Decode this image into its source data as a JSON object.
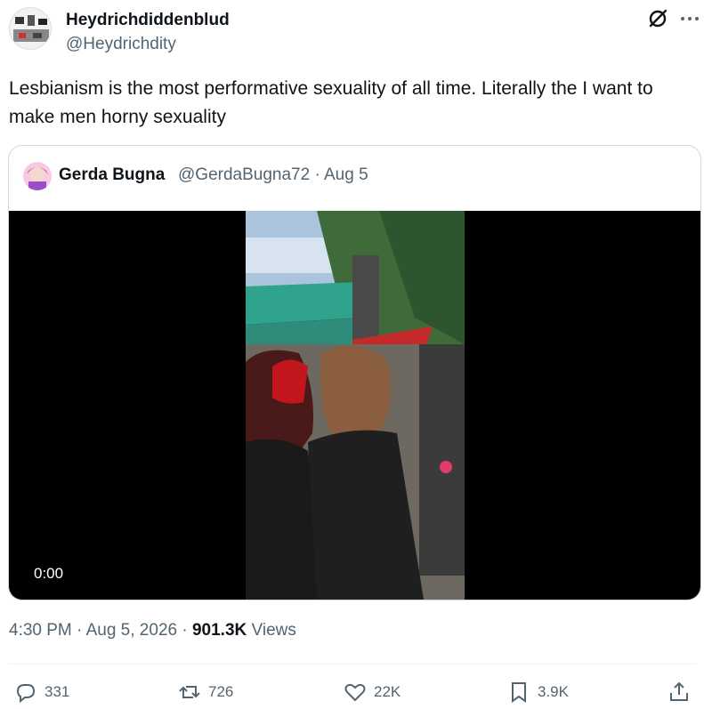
{
  "author": {
    "name": "Heydrichdiddenblud",
    "handle": "@Heydrichdity"
  },
  "tweet": {
    "text": "Lesbianism is the most performative sexuality of all time. Literally the I want to make men horny sexuality"
  },
  "quoted": {
    "name": "Gerda Bugna",
    "meta": "@GerdaBugna72 · Aug 5",
    "video_time": "0:00"
  },
  "meta": {
    "time": "4:30 PM · Aug 5, 2026 · ",
    "views_count": "901.3K",
    "views_label": " Views"
  },
  "actions": {
    "replies": "331",
    "reposts": "726",
    "likes": "22K",
    "bookmarks": "3.9K"
  },
  "icons": [
    "grok-icon",
    "more-icon",
    "reply-icon",
    "repost-icon",
    "like-icon",
    "bookmark-icon",
    "share-icon"
  ],
  "colors": {
    "text": "#0f1419",
    "secondary": "#536471",
    "border": "#cfd9de"
  }
}
